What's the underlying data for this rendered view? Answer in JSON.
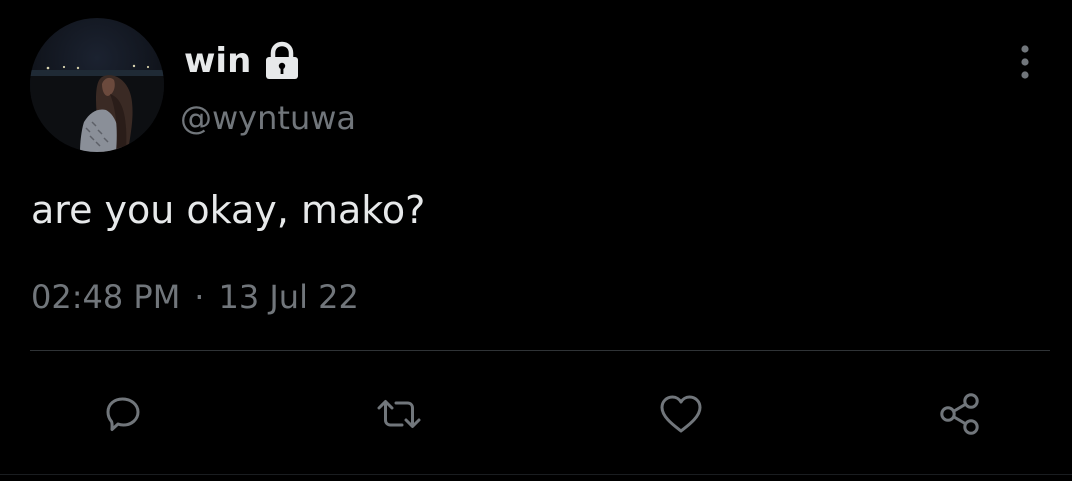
{
  "tweet": {
    "author": {
      "display_name": "win",
      "handle": "@wyntuwa",
      "protected_icon": "lock-icon",
      "avatar": "avatar-photo"
    },
    "text": "are you okay, mako?",
    "time": "02:48 PM",
    "separator": "·",
    "date": "13 Jul 22"
  },
  "actions": [
    {
      "icon": "reply-icon"
    },
    {
      "icon": "retweet-icon"
    },
    {
      "icon": "like-icon"
    },
    {
      "icon": "share-icon"
    }
  ],
  "menu": {
    "icon": "more-vertical-icon"
  },
  "colors": {
    "background": "#000000",
    "primary_text": "#e7e9ea",
    "secondary_text": "#71767b",
    "divider": "#2f3336"
  }
}
